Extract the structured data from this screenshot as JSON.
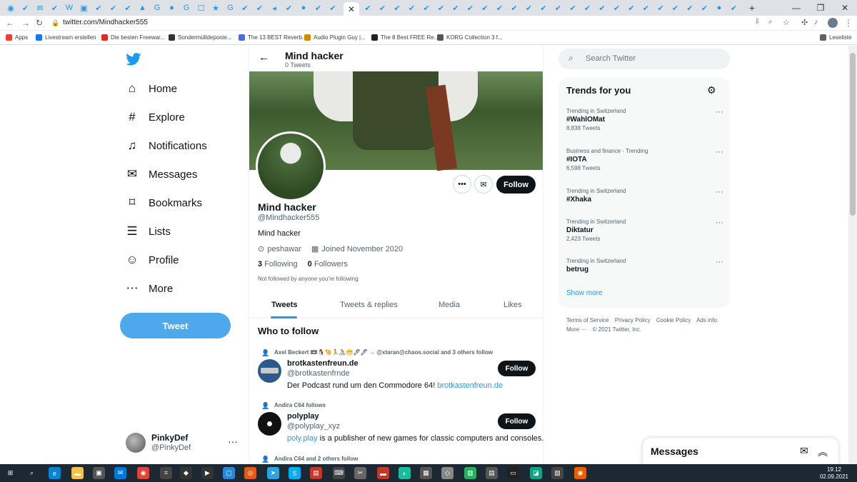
{
  "browser": {
    "url": "twitter.com/Mindhacker555",
    "active_tab_close": "✕",
    "new_tab": "+",
    "bookmarks": [
      {
        "label": "Apps",
        "color": "#e94235"
      },
      {
        "label": "Livestream erstellen",
        "color": "#1877f2"
      },
      {
        "label": "Die besten Freewar...",
        "color": "#d93025"
      },
      {
        "label": "Sondermülldeponie...",
        "color": "#333333"
      },
      {
        "label": "The 13 BEST Reverb...",
        "color": "#4a6ee0"
      },
      {
        "label": "Audio Plugin Guy |...",
        "color": "#c98f00"
      },
      {
        "label": "The 8 Best FREE Re...",
        "color": "#222222"
      },
      {
        "label": "KORG Collection 3 f...",
        "color": "#555555"
      }
    ],
    "reading_list": "Leseliste"
  },
  "sidebar": {
    "items": [
      {
        "label": "Home",
        "icon": "home-icon",
        "glyph": "⌂"
      },
      {
        "label": "Explore",
        "icon": "hashtag-icon",
        "glyph": "#"
      },
      {
        "label": "Notifications",
        "icon": "bell-icon",
        "glyph": "♫"
      },
      {
        "label": "Messages",
        "icon": "envelope-icon",
        "glyph": "✉"
      },
      {
        "label": "Bookmarks",
        "icon": "bookmark-icon",
        "glyph": "⌑"
      },
      {
        "label": "Lists",
        "icon": "list-icon",
        "glyph": "☰"
      },
      {
        "label": "Profile",
        "icon": "person-icon",
        "glyph": "☺"
      },
      {
        "label": "More",
        "icon": "more-circle-icon",
        "glyph": "⋯"
      }
    ],
    "tweet_button": "Tweet",
    "account": {
      "name": "PinkyDef",
      "handle": "@PinkyDef",
      "more": "···"
    }
  },
  "profile": {
    "header_title": "Mind hacker",
    "header_subtitle": "0 Tweets",
    "name": "Mind hacker",
    "handle": "@Mindhacker555",
    "bio": "Mind hacker",
    "location": "peshawar",
    "joined": "Joined November 2020",
    "following_count": "3",
    "following_label": "Following",
    "followers_count": "0",
    "followers_label": "Followers",
    "not_followed": "Not followed by anyone you’re following",
    "follow_button": "Follow",
    "tabs": [
      "Tweets",
      "Tweets & replies",
      "Media",
      "Likes"
    ]
  },
  "who_to_follow": {
    "title": "Who to follow",
    "suggestions": [
      {
        "context": "Axel Beckert 📼🐧🐪🏃🚴😁🖊🖊 → @xtaran@chaos.social and 3 others follow",
        "name": "brotkastenfreun.de",
        "handle": "@brotkastenfrnde",
        "desc": "Der Podcast rund um den Commodore 64! ",
        "link": "brotkastenfreun.de",
        "button": "Follow"
      },
      {
        "context": "Andira C64 follows",
        "name": "polyplay",
        "handle": "@polyplay_xyz",
        "desc_link": "poly.play",
        "desc": " is a publisher of new games for classic computers and consoles.",
        "button": "Follow"
      },
      {
        "context": "Andira C64 and 2 others follow"
      }
    ]
  },
  "search": {
    "placeholder": "Search Twitter"
  },
  "trends": {
    "title": "Trends for you",
    "items": [
      {
        "context": "Trending in Switzerland",
        "name": "#WahlOMat",
        "count": "8,838 Tweets"
      },
      {
        "context": "Business and finance · Trending",
        "name": "#IOTA",
        "count": "6,598 Tweets"
      },
      {
        "context": "Trending in Switzerland",
        "name": "#Xhaka",
        "count": ""
      },
      {
        "context": "Trending in Switzerland",
        "name": "Diktatur",
        "count": "2,423 Tweets"
      },
      {
        "context": "Trending in Switzerland",
        "name": "betrug",
        "count": ""
      }
    ],
    "show_more": "Show more"
  },
  "footer": {
    "links": [
      "Terms of Service",
      "Privacy Policy",
      "Cookie Policy",
      "Ads info",
      "More ···",
      "© 2021 Twitter, Inc."
    ]
  },
  "messages_drawer": {
    "title": "Messages"
  },
  "taskbar": {
    "time": "19:12",
    "date": "02.09.2021"
  }
}
